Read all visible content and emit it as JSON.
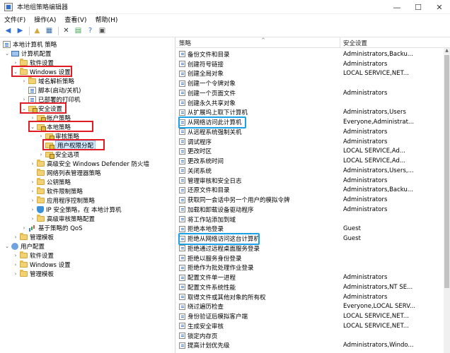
{
  "window": {
    "title": "本地组策略编辑器",
    "controls": {
      "minimize": "—",
      "maximize": "☐",
      "close": "✕"
    }
  },
  "menu": [
    "文件(F)",
    "操作(A)",
    "查看(V)",
    "帮助(H)"
  ],
  "toolbar": [
    "back-icon",
    "forward-icon",
    "up-folder-icon",
    "show-hide-tree-icon",
    "delete-icon",
    "export-list-icon",
    "help-icon",
    "properties-icon"
  ],
  "tree": {
    "root": "本地计算机 策略",
    "computer_config": "计算机配置",
    "software_settings": "软件设置",
    "windows_settings": "Windows 设置",
    "name_resolution": "域名解析策略",
    "scripts": "脚本(启动/关机)",
    "deployed_printers": "已部署的打印机",
    "security_settings": "安全设置",
    "account_policies": "帐户策略",
    "local_policies": "本地策略",
    "audit_policy": "审核策略",
    "user_rights": "用户权限分配",
    "security_options": "安全选项",
    "defender_firewall": "高级安全 Windows Defender 防火墙",
    "network_list": "网络列表管理器策略",
    "public_key": "公钥策略",
    "software_restriction": "软件限制策略",
    "app_control": "应用程序控制策略",
    "ipsec": "IP 安全策略，在 本地计算机",
    "advanced_audit": "高级审核策略配置",
    "qos": "基于策略的 QoS",
    "admin_templates": "管理模板",
    "user_config": "用户配置",
    "user_software": "软件设置",
    "user_windows": "Windows 设置",
    "user_admin": "管理模板"
  },
  "columns": {
    "policy": "策略",
    "security_setting": "安全设置"
  },
  "policies": [
    {
      "name": "备份文件和目录",
      "setting": "Administrators,Backu..."
    },
    {
      "name": "创建符号链接",
      "setting": "Administrators"
    },
    {
      "name": "创建全局对象",
      "setting": "LOCAL SERVICE,NET..."
    },
    {
      "name": "创建一个令牌对象",
      "setting": ""
    },
    {
      "name": "创建一个页面文件",
      "setting": "Administrators"
    },
    {
      "name": "创建永久共享对象",
      "setting": ""
    },
    {
      "name": "从扩展坞上取下计算机",
      "setting": "Administrators,Users"
    },
    {
      "name": "从网络访问此计算机",
      "setting": "Everyone,Administrat..."
    },
    {
      "name": "从远程系统强制关机",
      "setting": "Administrators"
    },
    {
      "name": "调试程序",
      "setting": "Administrators"
    },
    {
      "name": "更改时区",
      "setting": "LOCAL SERVICE,Ad..."
    },
    {
      "name": "更改系统时间",
      "setting": "LOCAL SERVICE,Ad..."
    },
    {
      "name": "关闭系统",
      "setting": "Administrators,Users,..."
    },
    {
      "name": "管理审核和安全日志",
      "setting": "Administrators"
    },
    {
      "name": "还原文件和目录",
      "setting": "Administrators,Backu..."
    },
    {
      "name": "获取同一会话中另一个用户的模拟令牌",
      "setting": "Administrators"
    },
    {
      "name": "加载和卸载设备驱动程序",
      "setting": "Administrators"
    },
    {
      "name": "将工作站添加到域",
      "setting": ""
    },
    {
      "name": "拒绝本地登录",
      "setting": "Guest"
    },
    {
      "name": "拒绝从网络访问这台计算机",
      "setting": "Guest"
    },
    {
      "name": "拒绝通过远程桌面服务登录",
      "setting": ""
    },
    {
      "name": "拒绝以服务身份登录",
      "setting": ""
    },
    {
      "name": "拒绝作为批处理作业登录",
      "setting": ""
    },
    {
      "name": "配置文件单一进程",
      "setting": "Administrators"
    },
    {
      "name": "配置文件系统性能",
      "setting": "Administrators,NT SE..."
    },
    {
      "name": "取得文件或其他对象的所有权",
      "setting": "Administrators"
    },
    {
      "name": "绕过遍历检查",
      "setting": "Everyone,LOCAL SERV..."
    },
    {
      "name": "身份验证后模拟客户端",
      "setting": "LOCAL SERVICE,NET..."
    },
    {
      "name": "生成安全审核",
      "setting": "LOCAL SERVICE,NET..."
    },
    {
      "name": "锁定内存页",
      "setting": ""
    },
    {
      "name": "提高计划优先级",
      "setting": "Administrators,Windo..."
    }
  ]
}
